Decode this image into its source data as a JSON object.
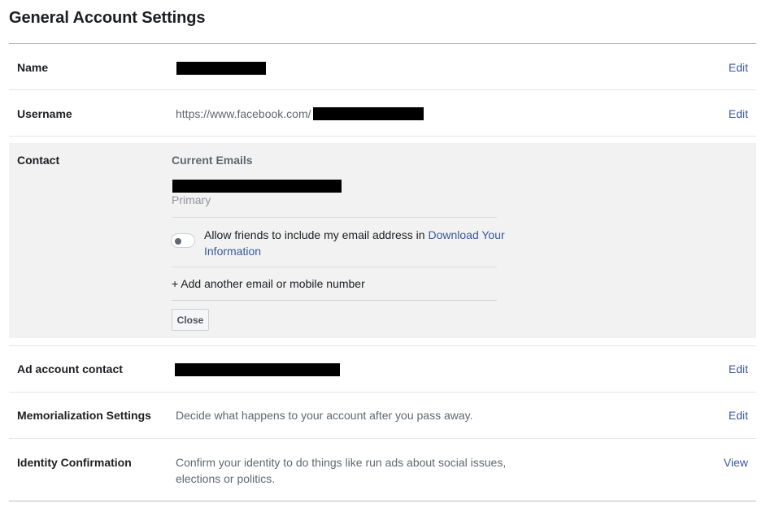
{
  "page": {
    "title": "General Account Settings"
  },
  "rows": {
    "name": {
      "label": "Name",
      "action": "Edit"
    },
    "username": {
      "label": "Username",
      "url_prefix": "https://www.facebook.com/",
      "action": "Edit"
    },
    "contact": {
      "label": "Contact",
      "current_emails_heading": "Current Emails",
      "primary_label": "Primary",
      "allow_text": "Allow friends to include my email address in ",
      "allow_link": "Download Your Information",
      "toggle_state": "off",
      "add_email": "+ Add another email or mobile number",
      "close_label": "Close"
    },
    "ad_account": {
      "label": "Ad account contact",
      "action": "Edit"
    },
    "memorialization": {
      "label": "Memorialization Settings",
      "description": "Decide what happens to your account after you pass away.",
      "action": "Edit"
    },
    "identity": {
      "label": "Identity Confirmation",
      "description": "Confirm your identity to do things like run ads about social issues, elections or politics.",
      "action": "View"
    }
  },
  "colors": {
    "link": "#385898",
    "panel_bg": "#f2f2f2",
    "redaction": "#000000"
  }
}
